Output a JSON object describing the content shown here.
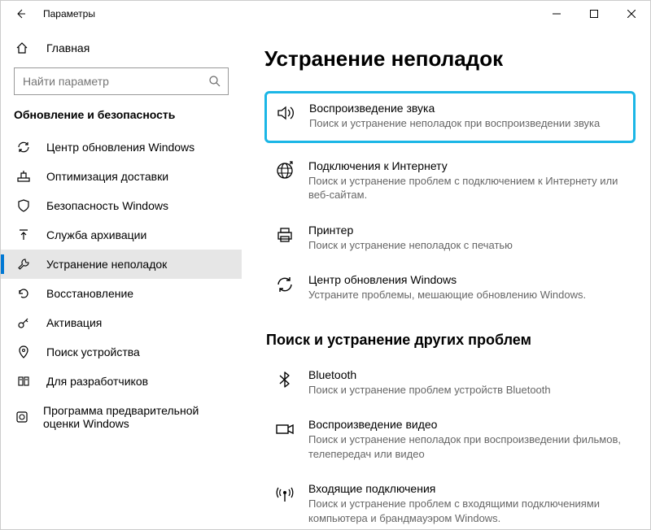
{
  "window": {
    "title": "Параметры"
  },
  "sidebar": {
    "home": "Главная",
    "search_placeholder": "Найти параметр",
    "section": "Обновление и безопасность",
    "items": [
      {
        "label": "Центр обновления Windows"
      },
      {
        "label": "Оптимизация доставки"
      },
      {
        "label": "Безопасность Windows"
      },
      {
        "label": "Служба архивации"
      },
      {
        "label": "Устранение неполадок"
      },
      {
        "label": "Восстановление"
      },
      {
        "label": "Активация"
      },
      {
        "label": "Поиск устройства"
      },
      {
        "label": "Для разработчиков"
      },
      {
        "label": "Программа предварительной оценки Windows"
      }
    ]
  },
  "main": {
    "title": "Устранение неполадок",
    "items": [
      {
        "title": "Воспроизведение звука",
        "desc": "Поиск и устранение неполадок при воспроизведении звука"
      },
      {
        "title": "Подключения к Интернету",
        "desc": "Поиск и устранение проблем с подключением к Интернету или веб-сайтам."
      },
      {
        "title": "Принтер",
        "desc": "Поиск и устранение неполадок с печатью"
      },
      {
        "title": "Центр обновления Windows",
        "desc": "Устраните проблемы, мешающие обновлению Windows."
      }
    ],
    "subsection": "Поиск и устранение других проблем",
    "items2": [
      {
        "title": "Bluetooth",
        "desc": "Поиск и устранение проблем устройств Bluetooth"
      },
      {
        "title": "Воспроизведение видео",
        "desc": "Поиск и устранение неполадок при воспроизведении фильмов, телепередач или видео"
      },
      {
        "title": "Входящие подключения",
        "desc": "Поиск и устранение проблем с входящими подключениями компьютера и брандмауэром Windows."
      }
    ]
  }
}
